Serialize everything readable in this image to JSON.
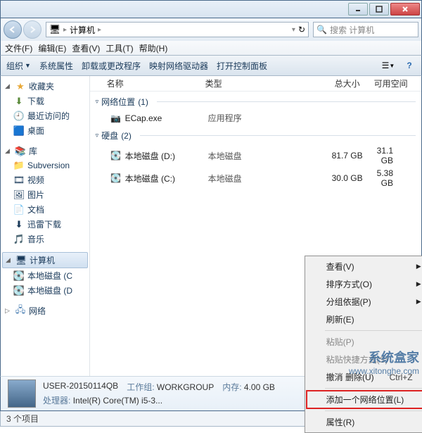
{
  "titlebar": {},
  "nav": {
    "breadcrumb": "计算机",
    "search_placeholder": "搜索 计算机"
  },
  "menubar": {
    "file": "文件(F)",
    "edit": "编辑(E)",
    "view": "查看(V)",
    "tools": "工具(T)",
    "help": "帮助(H)"
  },
  "toolbar": {
    "organize": "组织",
    "sysprops": "系统属性",
    "uninstall": "卸载或更改程序",
    "mapdrive": "映射网络驱动器",
    "ctrlpanel": "打开控制面板"
  },
  "columns": {
    "name": "名称",
    "type": "类型",
    "total": "总大小",
    "free": "可用空间"
  },
  "sidebar": {
    "favorites": "收藏夹",
    "downloads": "下载",
    "recent": "最近访问的",
    "desktop": "桌面",
    "libraries": "库",
    "subversion": "Subversion",
    "videos": "视频",
    "pictures": "图片",
    "documents": "文档",
    "xunlei": "迅雷下载",
    "music": "音乐",
    "computer": "计算机",
    "drive_c": "本地磁盘 (C",
    "drive_d": "本地磁盘 (D",
    "network": "网络"
  },
  "groups": {
    "netloc": {
      "label": "网络位置",
      "count": "(1)"
    },
    "drives": {
      "label": "硬盘",
      "count": "(2)"
    }
  },
  "items": {
    "ecap": {
      "name": "ECap.exe",
      "type": "应用程序"
    },
    "d": {
      "name": "本地磁盘 (D:)",
      "type": "本地磁盘",
      "total": "81.7 GB",
      "free": "31.1 GB"
    },
    "c": {
      "name": "本地磁盘 (C:)",
      "type": "本地磁盘",
      "total": "30.0 GB",
      "free": "5.38 GB"
    }
  },
  "context": {
    "view": "查看(V)",
    "sort": "排序方式(O)",
    "group": "分组依据(P)",
    "refresh": "刷新(E)",
    "paste": "粘贴(P)",
    "paste_sc": "粘贴快捷方式(S)",
    "undo": "撤消 删除(U)",
    "undo_sc": "Ctrl+Z",
    "addnet": "添加一个网络位置(L)",
    "props": "属性(R)"
  },
  "details": {
    "name": "USER-20150114QB",
    "workgroup_lbl": "工作组:",
    "workgroup": "WORKGROUP",
    "memory_lbl": "内存:",
    "memory": "4.00 GB",
    "cpu_lbl": "处理器:",
    "cpu": "Intel(R) Core(TM) i5-3..."
  },
  "status": {
    "text": "3 个项目"
  },
  "watermark": {
    "brand": "系统盒家",
    "url": "www.xitonghe.com"
  }
}
